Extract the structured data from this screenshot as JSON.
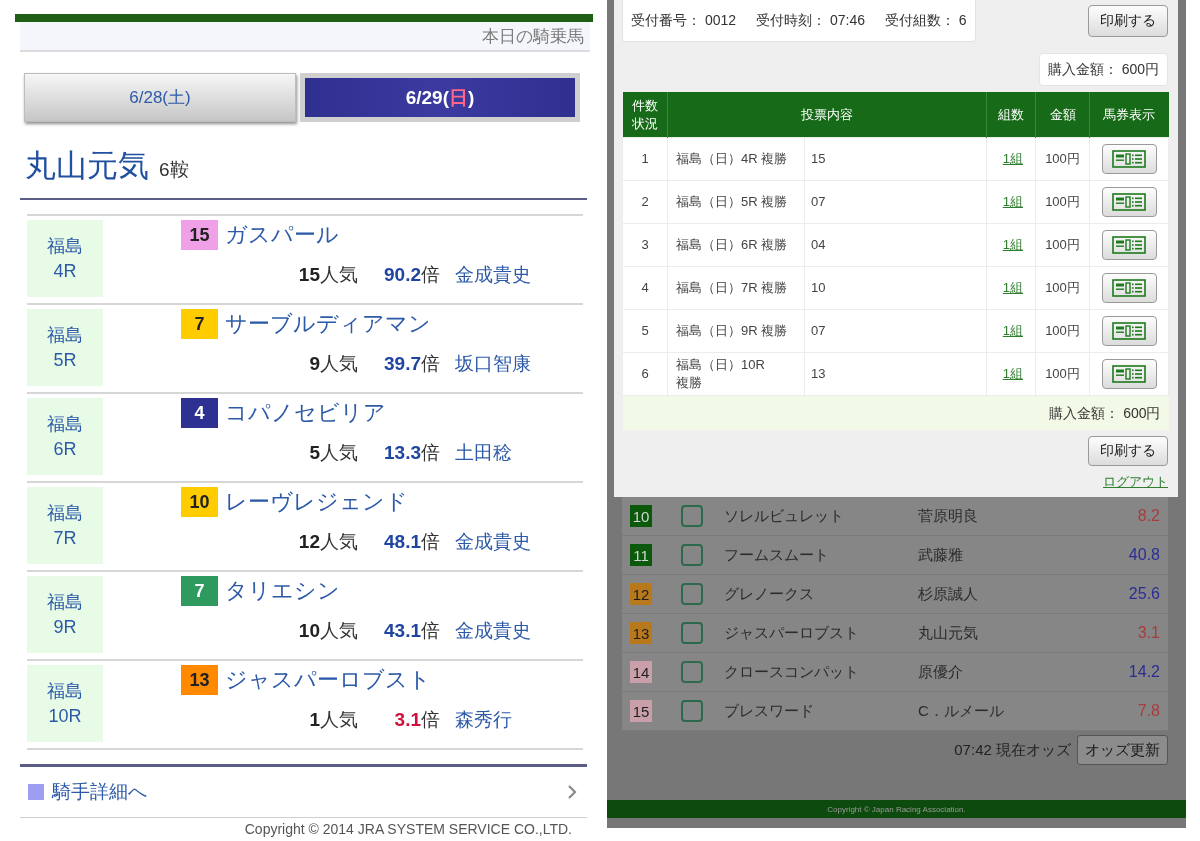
{
  "left_screen": {
    "subheader": "本日の騎乗馬",
    "tabs": [
      {
        "label_parts": [
          {
            "text": "6/28("
          },
          {
            "text": "土"
          },
          {
            "text": ")"
          }
        ],
        "selected": false
      },
      {
        "label_parts": [
          {
            "text": "6/29("
          },
          {
            "text": "日",
            "color": "#ff6688"
          },
          {
            "text": ")"
          }
        ],
        "selected": true
      }
    ],
    "jockey": {
      "name": "丸山元気",
      "mounts": "6鞍"
    },
    "rides": [
      {
        "venue": "福島",
        "race": "4R",
        "badge": {
          "number": "15",
          "color": "#f0a0e6"
        },
        "horse": "ガスパール",
        "popularity": "**15**人気",
        "odds": {
          "value": "90.2",
          "unit": "倍",
          "color": "#1f45a0"
        },
        "rider": "金成貴史"
      },
      {
        "venue": "福島",
        "race": "5R",
        "badge": {
          "number": "7",
          "color": "#ffcc00"
        },
        "horse": "サーブルディアマン",
        "popularity": "**9**人気",
        "odds": {
          "value": "39.7",
          "unit": "倍",
          "color": "#1f45a0"
        },
        "rider": "坂口智康"
      },
      {
        "venue": "福島",
        "race": "6R",
        "badge": {
          "number": "4",
          "color": "#2e3192"
        },
        "horse": "コパノセビリア",
        "popularity": "**5**人気",
        "odds": {
          "value": "13.3",
          "unit": "倍",
          "color": "#1f45a0"
        },
        "rider": "土田稔"
      },
      {
        "venue": "福島",
        "race": "7R",
        "badge": {
          "number": "10",
          "color": "#ffcc00"
        },
        "horse": "レーヴレジェンド",
        "popularity": "**12**人気",
        "odds": {
          "value": "48.1",
          "unit": "倍",
          "color": "#1f45a0"
        },
        "rider": "金成貴史"
      },
      {
        "venue": "福島",
        "race": "9R",
        "badge": {
          "number": "7",
          "color": "#2e9a60"
        },
        "horse": "タリエシン",
        "popularity": "**10**人気",
        "odds": {
          "value": "43.1",
          "unit": "倍",
          "color": "#1f45a0"
        },
        "rider": "金成貴史"
      },
      {
        "venue": "福島",
        "race": "10R",
        "badge": {
          "number": "13",
          "color": "#ff8a00"
        },
        "horse": "ジャスパーロブスト",
        "popularity": "**1**人気",
        "odds": {
          "value": "3.1",
          "unit": "倍",
          "color": "#d0103a"
        },
        "rider": "森秀行"
      }
    ],
    "detail_link": "騎手詳細へ",
    "copyright": "Copyright © 2014 JRA SYSTEM SERVICE CO.,LTD."
  },
  "right_screen": {
    "receipt": [
      "受付番号： 0012",
      "受付時刻： 07:46",
      "受付組数： 6"
    ],
    "print_button_top": "印刷する",
    "total_top": "購入金額： 600円",
    "table": {
      "columns": [
        "件数状況",
        "投票内容",
        "組数",
        "金額",
        "馬券表示"
      ],
      "rows": [
        {
          "no": "1",
          "race": "福島（日）4R 複勝",
          "selection": "15",
          "count": "1組",
          "amount": "100円"
        },
        {
          "no": "2",
          "race": "福島（日）5R 複勝",
          "selection": "07",
          "count": "1組",
          "amount": "100円"
        },
        {
          "no": "3",
          "race": "福島（日）6R 複勝",
          "selection": "04",
          "count": "1組",
          "amount": "100円"
        },
        {
          "no": "4",
          "race": "福島（日）7R 複勝",
          "selection": "10",
          "count": "1組",
          "amount": "100円"
        },
        {
          "no": "5",
          "race": "福島（日）9R 複勝",
          "selection": "07",
          "count": "1組",
          "amount": "100円"
        },
        {
          "no": "6",
          "race": "福島（日）10R 複勝",
          "selection": "13",
          "count": "1組",
          "amount": "100円"
        }
      ],
      "total": "購入金額： 600円"
    },
    "print_button_bottom": "印刷する",
    "logout_link": "ログアウト",
    "odds_board": {
      "rows": [
        {
          "badge": {
            "number": "10",
            "color": "#0b5a0b"
          },
          "checked": false,
          "horse": "ソレルビュレット",
          "jockey": "菅原明良",
          "odds": {
            "text": "8.2",
            "color": "#a83c3c"
          }
        },
        {
          "badge": {
            "number": "11",
            "color": "#0b5a0b"
          },
          "checked": false,
          "horse": "フームスムート",
          "jockey": "武藤雅",
          "odds": {
            "text": "40.8",
            "color": "#2c2c96"
          }
        },
        {
          "badge": {
            "number": "12",
            "color": "#b8791c"
          },
          "checked": false,
          "horse": "グレノークス",
          "jockey": "杉原誠人",
          "odds": {
            "text": "25.6",
            "color": "#2c2c96"
          }
        },
        {
          "badge": {
            "number": "13",
            "color": "#b8791c"
          },
          "checked": false,
          "horse": "ジャスパーロブスト",
          "jockey": "丸山元気",
          "odds": {
            "text": "3.1",
            "color": "#a83c3c"
          }
        },
        {
          "badge": {
            "number": "14",
            "color": "#c9a0aa"
          },
          "checked": false,
          "horse": "クロースコンパット",
          "jockey": "原優介",
          "odds": {
            "text": "14.2",
            "color": "#2c2c96"
          }
        },
        {
          "badge": {
            "number": "15",
            "color": "#c9a0aa"
          },
          "checked": false,
          "horse": "ブレスワード",
          "jockey": "C．ルメール",
          "odds": {
            "text": "7.8",
            "color": "#a83c3c"
          }
        }
      ],
      "updated": "07:42 現在オッズ",
      "refresh_button": "オッズ更新"
    },
    "footer": "Copyright © Japan Racing Association."
  }
}
